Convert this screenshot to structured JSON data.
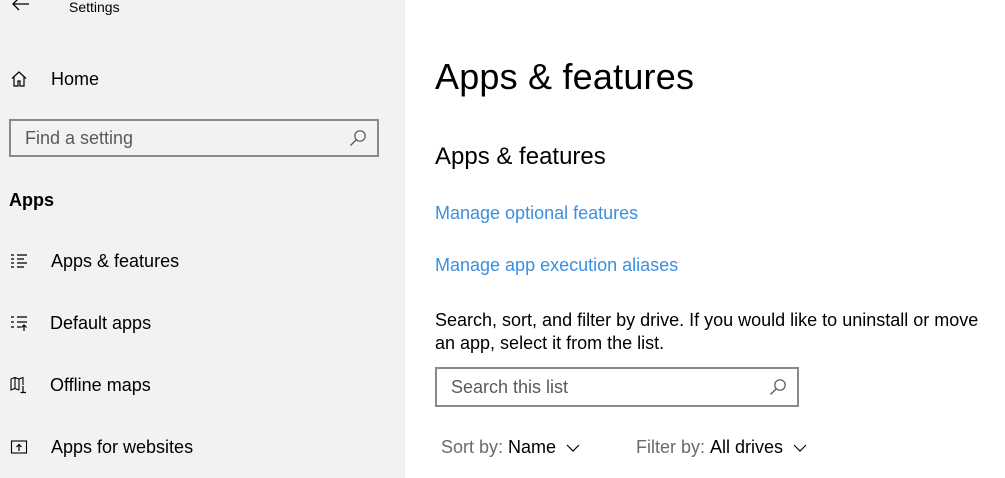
{
  "window": {
    "title": "Settings"
  },
  "sidebar": {
    "home_label": "Home",
    "search_placeholder": "Find a setting",
    "section_heading": "Apps",
    "items": [
      {
        "label": "Apps & features",
        "icon": "list-icon"
      },
      {
        "label": "Default apps",
        "icon": "default-apps-icon"
      },
      {
        "label": "Offline maps",
        "icon": "map-icon"
      },
      {
        "label": "Apps for websites",
        "icon": "open-in-app-icon"
      }
    ]
  },
  "main": {
    "page_title": "Apps & features",
    "section_title": "Apps & features",
    "links": [
      "Manage optional features",
      "Manage app execution aliases"
    ],
    "description": "Search, sort, and filter by drive. If you would like to uninstall or move an app, select it from the list.",
    "list_search_placeholder": "Search this list",
    "sort": {
      "label": "Sort by:",
      "value": "Name"
    },
    "filter": {
      "label": "Filter by:",
      "value": "All drives"
    }
  },
  "colors": {
    "sidebar_bg": "#f2f2f2",
    "link": "#3b8fde",
    "border": "#8a8a8a"
  }
}
